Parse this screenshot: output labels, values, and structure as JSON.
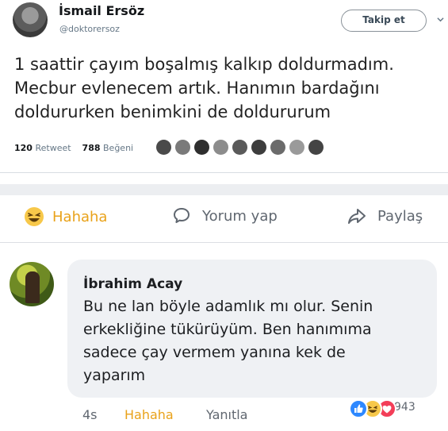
{
  "tweet": {
    "author_name": "İsmail Ersöz",
    "handle": "@doktorersoz",
    "follow_label": "Takip et",
    "text_lines": [
      "1 saattir çayım boşalmış kalkıp doldurmadım.",
      "Mecbur evlenecem artık. Hanımın bardağını",
      "doldururken benimkini de doldururum"
    ],
    "retweet_count": "120",
    "retweet_label": "Retweet",
    "like_count": "788",
    "like_label": "Beğeni"
  },
  "actions": {
    "haha_label": "Hahaha",
    "comment_label": "Yorum yap",
    "share_label": "Paylaş"
  },
  "comment": {
    "author_name": "İbrahim Acay",
    "text_lines": [
      "Bu ne lan böyle adamlık mı olur. Senin",
      "erkekliğine tükürüyüm. Ben hanımıma",
      "sadece çay vermem yanına kek de",
      "yaparım"
    ],
    "time": "4s",
    "reaction_label": "Hahaha",
    "reply_label": "Yanıtla",
    "reaction_count": "943"
  },
  "colors": {
    "haha": "#e9a21a",
    "like_blue": "#2d88ff",
    "love_red": "#f33e58",
    "twitter_gray": "#657786"
  },
  "icons": {
    "follow_menu": "chevron-down-icon",
    "haha": "haha-emoji-icon",
    "comment": "speech-bubble-icon",
    "share": "share-arrow-icon",
    "like": "thumbs-up-icon",
    "love": "heart-icon"
  }
}
